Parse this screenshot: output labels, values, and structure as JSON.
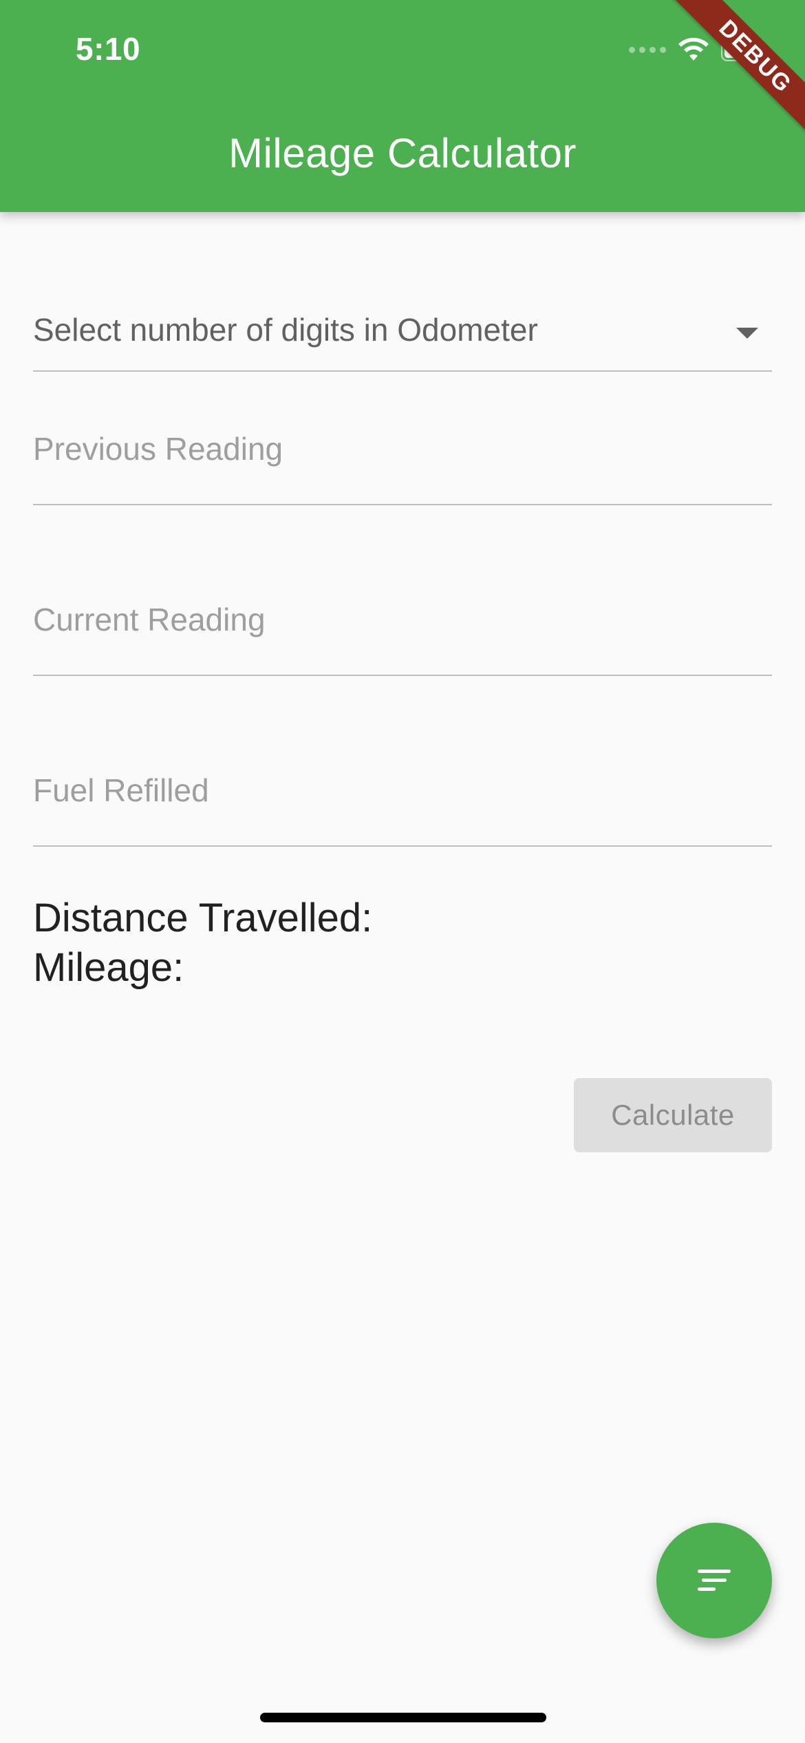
{
  "status_bar": {
    "time": "5:10"
  },
  "app_bar": {
    "title": "Mileage Calculator",
    "debug_banner": "DEBUG"
  },
  "form": {
    "digits_dropdown": {
      "placeholder": "Select number of digits in Odometer"
    },
    "previous_reading": {
      "placeholder": "Previous Reading",
      "value": ""
    },
    "current_reading": {
      "placeholder": "Current Reading",
      "value": ""
    },
    "fuel_refilled": {
      "placeholder": "Fuel Refilled",
      "value": ""
    }
  },
  "results": {
    "distance_label": "Distance Travelled:",
    "mileage_label": "Mileage:"
  },
  "actions": {
    "calculate_label": "Calculate"
  },
  "fab": {
    "icon": "sort-icon"
  },
  "colors": {
    "primary": "#4caf50",
    "debug_ribbon": "#8e2a1b",
    "disabled_button": "#dedede"
  }
}
